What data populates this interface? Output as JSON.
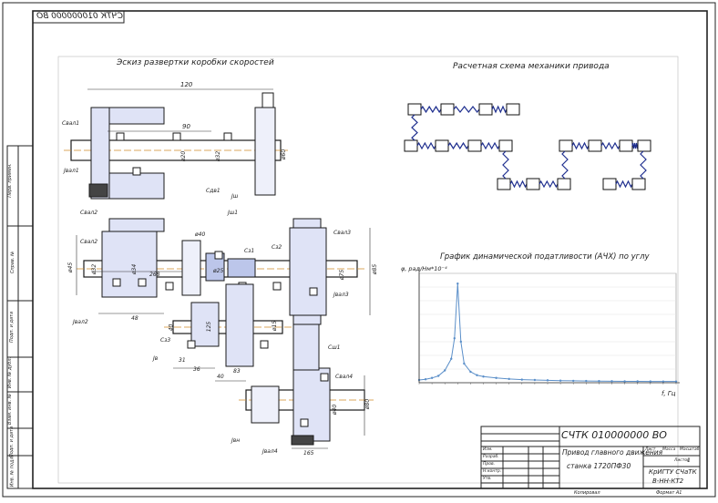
{
  "stamp_top": "СЧТК 010000000 ВО",
  "sections": {
    "gearbox_sketch_title": "Эскиз развертки коробки скоростей",
    "mechanics_scheme_title": "Расчетная схема механики привода",
    "afc_chart_title": "График динамической податливости (АЧХ) по углу"
  },
  "dimensions": {
    "d1": "120",
    "d2": "90",
    "d3": "ø20",
    "d4": "ø32",
    "d5": "ø60",
    "d6": "ø45",
    "d7": "ø32",
    "d8": "ø34",
    "d9": "ø85",
    "d10": "ø40",
    "d11": "ø25",
    "d12": "ø75",
    "d13": "ø15",
    "d14": "268",
    "d15": "48",
    "d16": "31",
    "d17": "40",
    "d18": "36",
    "d19": "83",
    "d20": "ø40",
    "d21": "ø80",
    "d22": "165",
    "d23": "40",
    "d24": "125"
  },
  "part_labels": {
    "l1": "Cвал1",
    "l2": "Jвал1",
    "l3": "Сдв1",
    "l4": "Jш",
    "l5": "Свал2",
    "l6": "Cвал2",
    "l7": "Сз1",
    "l8": "Jвал2",
    "l9": "Сз2",
    "l10": "Cвал3",
    "l11": "Jвал3",
    "l12": "Jв",
    "l13": "Сз3",
    "l14": "Сш1",
    "l15": "Cвал4",
    "l16": "Jвал4",
    "l17": "Jвн",
    "l18": "Jш1"
  },
  "chart_data": {
    "type": "line",
    "title": "График динамической податливости (АЧХ) по углу",
    "ylabel": "φ, рад/Нм*10⁻⁴",
    "xlabel": "f, Гц",
    "x": [
      0,
      1,
      2,
      3,
      4,
      5,
      5.5,
      6,
      6.5,
      7,
      8,
      9,
      10,
      12,
      14,
      16,
      18,
      20,
      22,
      24,
      26,
      28,
      30,
      32,
      34,
      36,
      38,
      40
    ],
    "y": [
      0.4,
      0.5,
      0.7,
      1.0,
      1.8,
      3.5,
      6.5,
      14.5,
      6.0,
      2.8,
      1.6,
      1.1,
      0.9,
      0.7,
      0.55,
      0.45,
      0.4,
      0.35,
      0.3,
      0.28,
      0.26,
      0.24,
      0.22,
      0.2,
      0.2,
      0.19,
      0.18,
      0.18
    ],
    "ylim": [
      0,
      16
    ],
    "xlim": [
      0,
      40
    ],
    "grid": true,
    "line_color": "#5b8fc9"
  },
  "title_block": {
    "designation": "СЧТК 010000000 ВО",
    "product_name_1": "Привод главного движения",
    "product_name_2": "станка 1720ПФ30",
    "org_1": "КрИГТУ СЧаТК",
    "org_2": "В-НН-КТ2",
    "sheet_label": "Лист",
    "sheets_label": "Листов",
    "mass_label": "Масса",
    "scale_label": "Масштаб",
    "scale_value": "1",
    "role_1": "Изм.",
    "role_2": "Разраб.",
    "role_3": "Пров.",
    "role_4": "Н.контр.",
    "role_5": "Утв.",
    "format": "Формат А1",
    "copied": "Копировал"
  },
  "side_stamps": {
    "s1": "Перв. примен.",
    "s2": "Справ. №",
    "s3": "Подп. и дата",
    "s4": "Инв. № дубл.",
    "s5": "Взам. инв. №",
    "s6": "Подп. и дата",
    "s7": "Инв. № подл."
  }
}
